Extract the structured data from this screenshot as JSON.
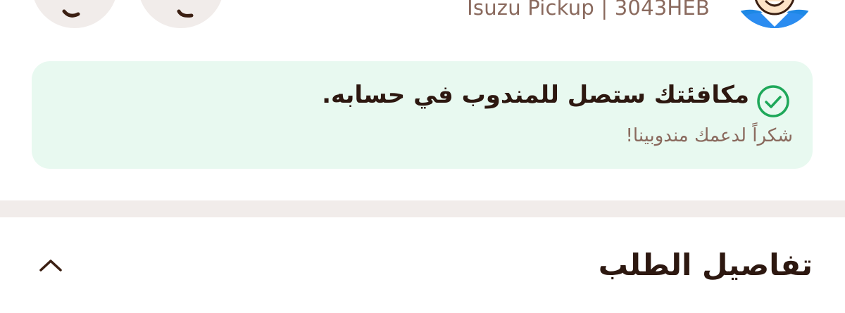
{
  "driver": {
    "vehicle_info": "Isuzu Pickup | 3043HEB",
    "avatar_icon": "driver-avatar-icon"
  },
  "actions": [
    {
      "name": "call-driver-button",
      "icon": "phone-icon"
    },
    {
      "name": "chat-driver-button",
      "icon": "chat-icon"
    }
  ],
  "reward_notice": {
    "icon": "check-circle-icon",
    "title": "مكافئتك ستصل للمندوب في حسابه.",
    "subtitle": "شكراً لدعمك مندوبينا!",
    "background_color": "#e8f9f0",
    "accent_color": "#1fa85a"
  },
  "order_details": {
    "title": "تفاصيل الطلب",
    "toggle_icon": "chevron-up-icon"
  },
  "colors": {
    "text_primary": "#2d1810",
    "text_secondary": "#8a6a5e",
    "divider": "#f1ecea"
  }
}
